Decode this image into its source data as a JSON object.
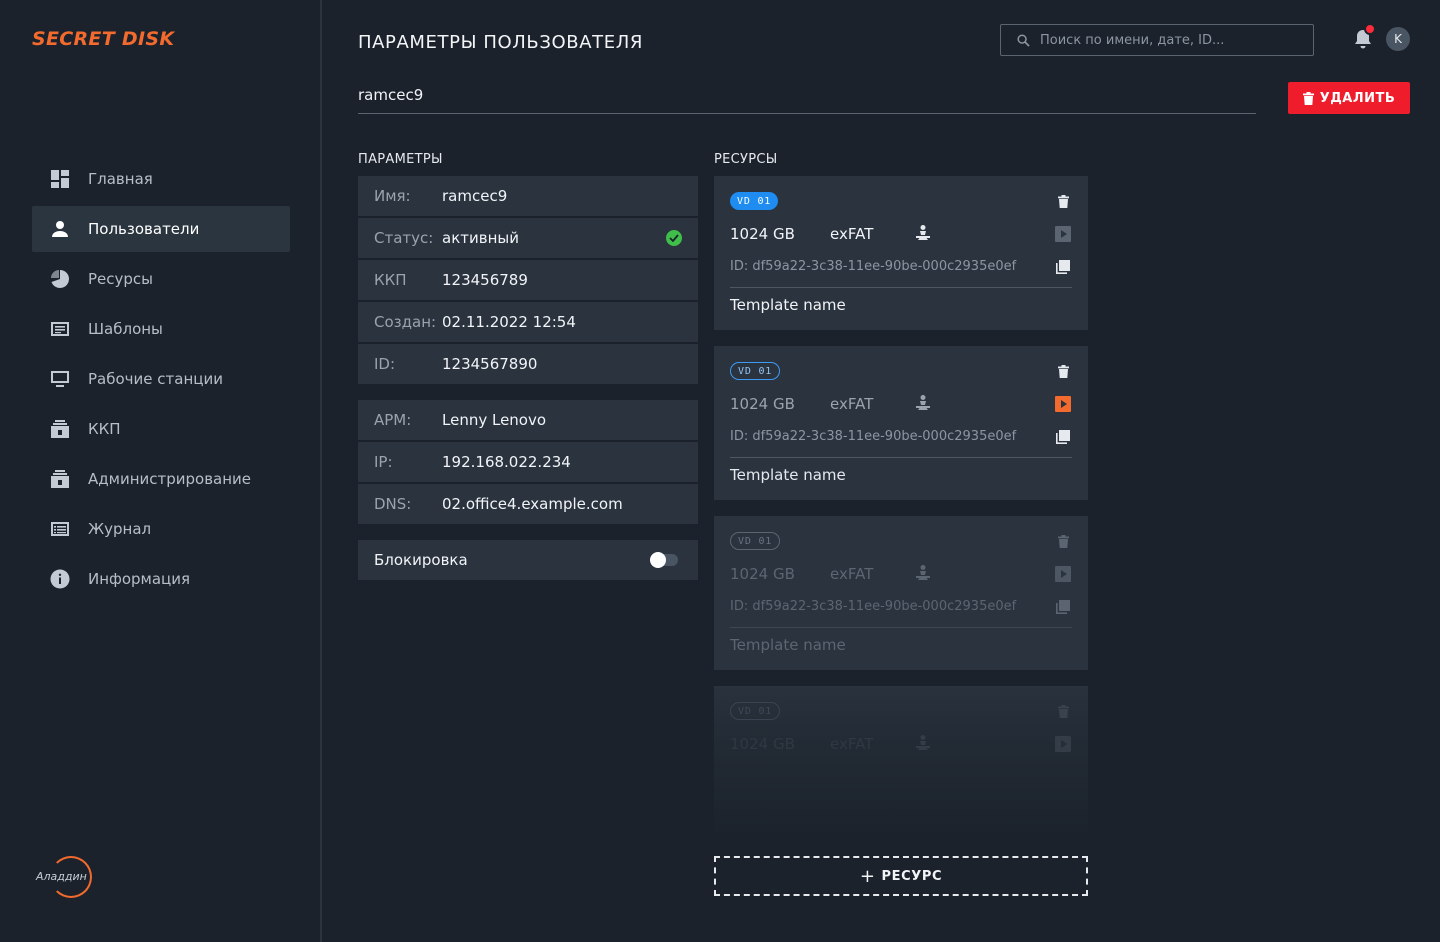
{
  "app": {
    "logo": "SECRET DISK",
    "vendor": "Аладдин",
    "accent": "#f26a2e"
  },
  "sidebar": {
    "items": [
      {
        "label": "Главная",
        "icon": "dashboard-icon",
        "active": false
      },
      {
        "label": "Пользователи",
        "icon": "user-icon",
        "active": true
      },
      {
        "label": "Ресурсы",
        "icon": "pie-chart-icon",
        "active": false
      },
      {
        "label": "Шаблоны",
        "icon": "template-icon",
        "active": false
      },
      {
        "label": "Рабочие станции",
        "icon": "monitor-icon",
        "active": false
      },
      {
        "label": "ККП",
        "icon": "lock-box-icon",
        "active": false
      },
      {
        "label": "Администрирование",
        "icon": "admin-icon",
        "active": false
      },
      {
        "label": "Журнал",
        "icon": "journal-icon",
        "active": false
      },
      {
        "label": "Информация",
        "icon": "info-icon",
        "active": false
      }
    ]
  },
  "header": {
    "title": "ПАРАМЕТРЫ ПОЛЬЗОВАТЕЛЯ",
    "search_placeholder": "Поиск по имени, дате, ID...",
    "avatar_initial": "K"
  },
  "user": {
    "name": "ramcec9",
    "delete_label": "УДАЛИТЬ"
  },
  "params": {
    "section_label": "ПАРАМЕТРЫ",
    "rows": [
      {
        "key": "Имя:",
        "value": "ramcec9"
      },
      {
        "key": "Статус:",
        "value": "активный"
      },
      {
        "key": "ККП",
        "value": "123456789"
      },
      {
        "key": "Создан:",
        "value": "02.11.2022 12:54"
      },
      {
        "key": "ID:",
        "value": "1234567890"
      },
      {
        "key": "АРМ:",
        "value": "Lenny Lenovo"
      },
      {
        "key": "IP:",
        "value": "192.168.022.234"
      },
      {
        "key": "DNS:",
        "value": "02.office4.example.com"
      }
    ],
    "lock_label": "Блокировка",
    "lock_enabled": false
  },
  "resources": {
    "section_label": "РЕСУРСЫ",
    "cards": [
      {
        "badge": "VD 01",
        "size": "1024 GB",
        "fs": "exFAT",
        "id": "ID: df59a22-3c38-11ee-90be-000c2935e0ef",
        "template": "Template name"
      },
      {
        "badge": "VD 01",
        "size": "1024 GB",
        "fs": "exFAT",
        "id": "ID: df59a22-3c38-11ee-90be-000c2935e0ef",
        "template": "Template name"
      },
      {
        "badge": "VD 01",
        "size": "1024 GB",
        "fs": "exFAT",
        "id": "ID: df59a22-3c38-11ee-90be-000c2935e0ef",
        "template": "Template name"
      },
      {
        "badge": "VD 01",
        "size": "1024 GB",
        "fs": "exFAT"
      }
    ],
    "add_label": "РЕСУРС"
  }
}
